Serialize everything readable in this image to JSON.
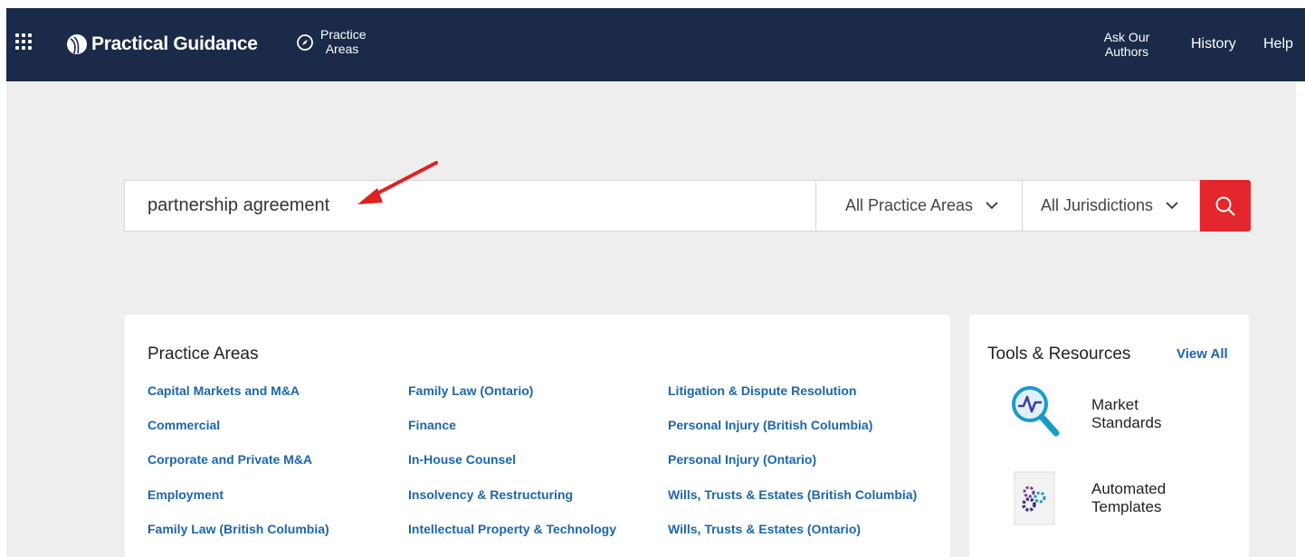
{
  "header": {
    "brand": "Practical Guidance",
    "practice_areas_nav": "Practice Areas",
    "nav_right": [
      "Ask Our Authors",
      "History",
      "Help"
    ]
  },
  "search": {
    "query": "partnership agreement",
    "practice_area_select": "All Practice Areas",
    "jurisdiction_select": "All Jurisdictions"
  },
  "practice_areas": {
    "title": "Practice Areas",
    "columns": [
      [
        "Capital Markets and M&A",
        "Commercial",
        "Corporate and Private M&A",
        "Employment",
        "Family Law (British Columbia)"
      ],
      [
        "Family Law (Ontario)",
        "Finance",
        "In-House Counsel",
        "Insolvency & Restructuring",
        "Intellectual Property & Technology"
      ],
      [
        "Litigation & Dispute Resolution",
        "Personal Injury (British Columbia)",
        "Personal Injury (Ontario)",
        "Wills, Trusts & Estates (British Columbia)",
        "Wills, Trusts & Estates (Ontario)"
      ]
    ]
  },
  "tools": {
    "title": "Tools & Resources",
    "view_all": "View All",
    "items": [
      {
        "label": "Market Standards",
        "icon": "market-standards-icon"
      },
      {
        "label": "Automated Templates",
        "icon": "automated-templates-icon"
      }
    ]
  },
  "colors": {
    "header_bg": "#1b2a48",
    "link": "#1b66ad",
    "search_button": "#e4272c",
    "annotation_arrow": "#e02020"
  }
}
